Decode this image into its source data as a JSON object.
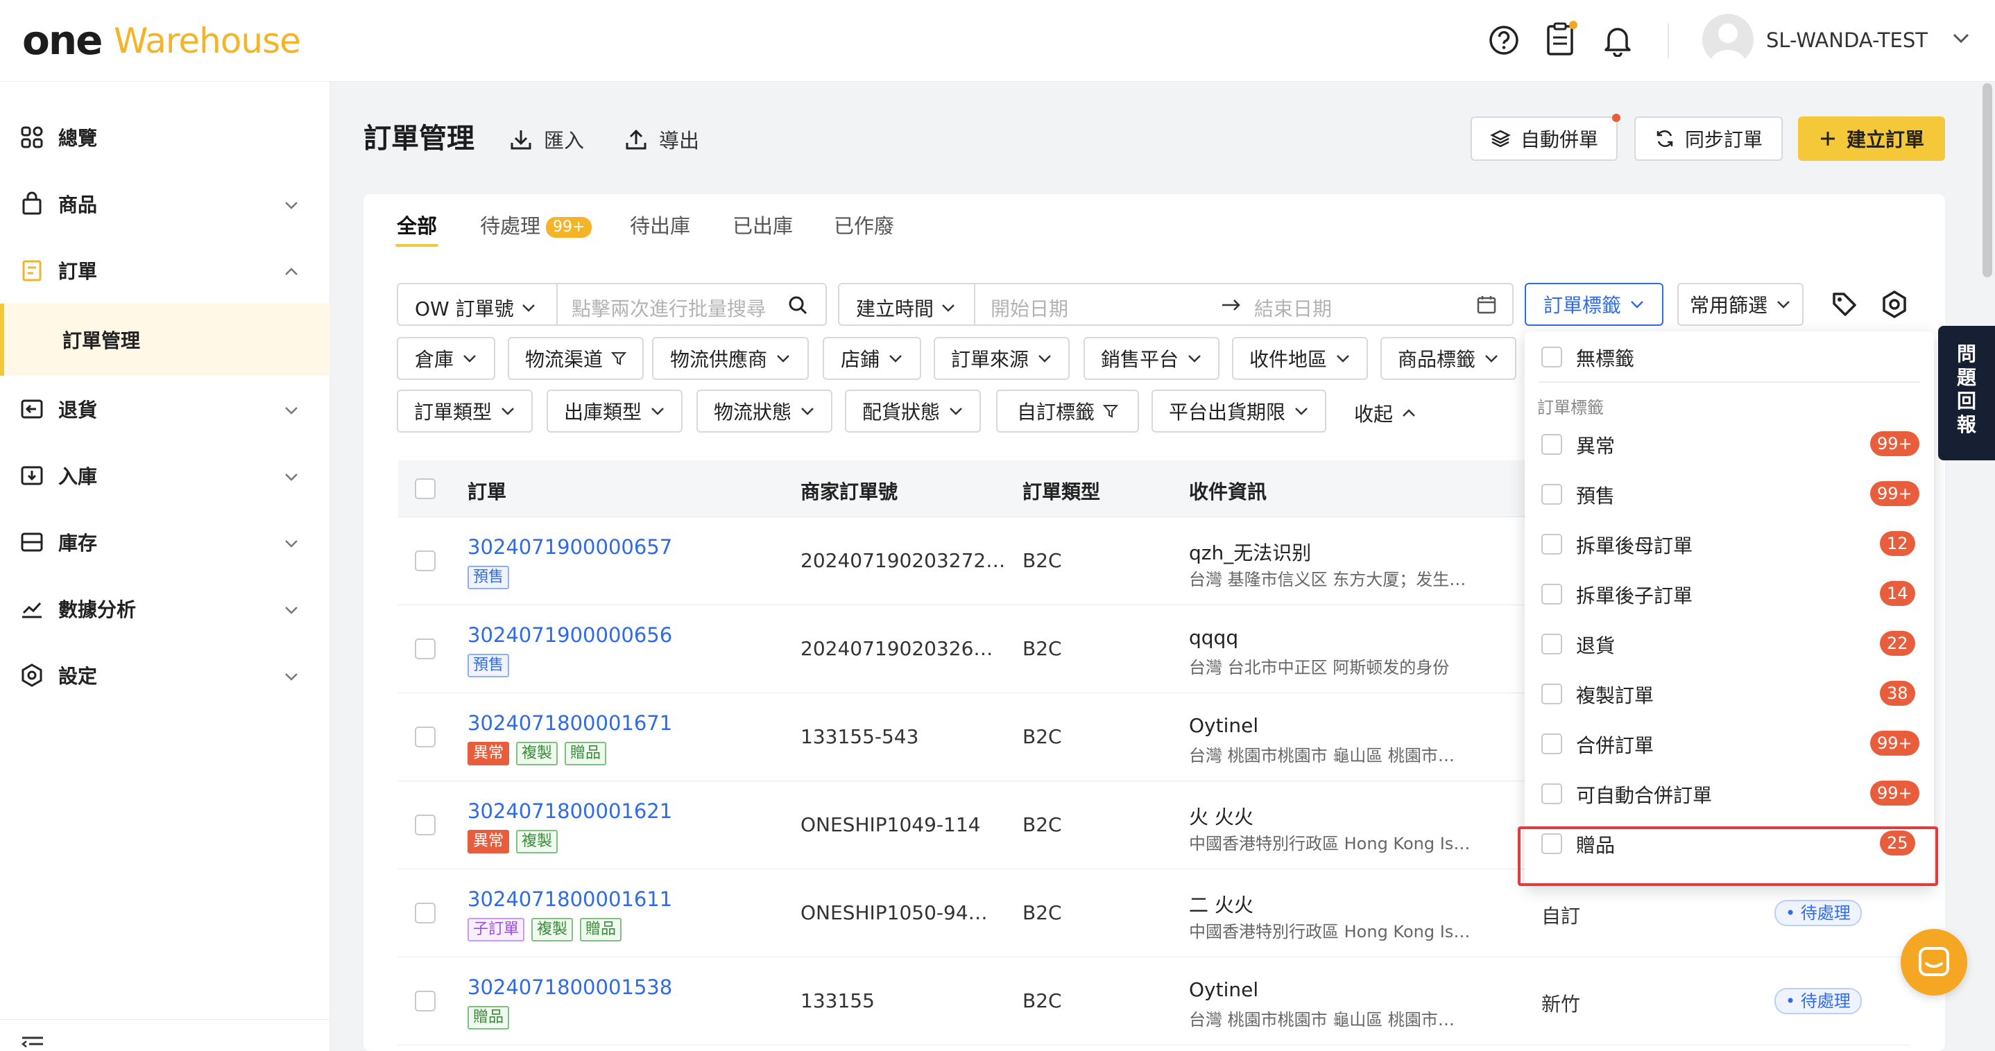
{
  "brand": {
    "part1": "one",
    "part2": "Warehouse"
  },
  "header": {
    "user": "SL-WANDA-TEST"
  },
  "sidebar": {
    "items": [
      {
        "label": "總覽"
      },
      {
        "label": "商品"
      },
      {
        "label": "訂單"
      },
      {
        "label": "訂單管理"
      },
      {
        "label": "退貨"
      },
      {
        "label": "入庫"
      },
      {
        "label": "庫存"
      },
      {
        "label": "數據分析"
      },
      {
        "label": "設定"
      }
    ]
  },
  "page": {
    "title": "訂單管理",
    "import": "匯入",
    "export": "導出",
    "auto_merge": "自動併單",
    "sync": "同步訂單",
    "create": "建立訂單"
  },
  "tabs": [
    {
      "label": "全部"
    },
    {
      "label": "待處理",
      "badge": "99+"
    },
    {
      "label": "待出庫"
    },
    {
      "label": "已出庫"
    },
    {
      "label": "已作廢"
    }
  ],
  "filters": {
    "order_no_select": "OW 訂單號",
    "search_placeholder": "點擊兩次進行批量搜尋",
    "time_select": "建立時間",
    "start_date": "開始日期",
    "end_date": "結束日期",
    "tag_select": "訂單標籤",
    "common": "常用篩選",
    "row2": [
      "倉庫",
      "物流渠道",
      "物流供應商",
      "店鋪",
      "訂單來源",
      "銷售平台",
      "收件地區",
      "商品標籤"
    ],
    "row3": [
      "訂單類型",
      "出庫類型",
      "物流狀態",
      "配貨狀態",
      "自訂標籤",
      "平台出貨期限"
    ],
    "collapse": "收起"
  },
  "table": {
    "headers": [
      "訂單",
      "商家訂單號",
      "訂單類型",
      "收件資訊"
    ],
    "rows": [
      {
        "order": "3024071900000657",
        "tags": [
          {
            "t": "預售",
            "c": "t-pre"
          }
        ],
        "merchant": "202407190203272…",
        "type": "B2C",
        "name": "qzh_无法识别",
        "addr": "台灣 基隆市信义区 东方大厦；发生…",
        "extra": "",
        "status": ""
      },
      {
        "order": "3024071900000656",
        "tags": [
          {
            "t": "預售",
            "c": "t-pre"
          }
        ],
        "merchant": "20240719020326…",
        "type": "B2C",
        "name": "qqqq",
        "addr": "台灣 台北市中正区 阿斯顿发的身份",
        "extra": "",
        "status": ""
      },
      {
        "order": "3024071800001671",
        "tags": [
          {
            "t": "異常",
            "c": "t-err"
          },
          {
            "t": "複製",
            "c": "t-copy"
          },
          {
            "t": "贈品",
            "c": "t-gift"
          }
        ],
        "merchant": "133155-543",
        "type": "B2C",
        "name": "Oytinel",
        "addr": "台灣 桃園市桃園市 龜山區 桃園市…",
        "extra": "",
        "status": ""
      },
      {
        "order": "3024071800001621",
        "tags": [
          {
            "t": "異常",
            "c": "t-err"
          },
          {
            "t": "複製",
            "c": "t-copy"
          }
        ],
        "merchant": "ONESHIP1049-114",
        "type": "B2C",
        "name": "火 火火",
        "addr": "中國香港特別行政區 Hong Kong Is…",
        "extra": "",
        "status": ""
      },
      {
        "order": "3024071800001611",
        "tags": [
          {
            "t": "子訂單",
            "c": "t-sub"
          },
          {
            "t": "複製",
            "c": "t-copy"
          },
          {
            "t": "贈品",
            "c": "t-gift"
          }
        ],
        "merchant": "ONESHIP1050-94…",
        "type": "B2C",
        "name": "二 火火",
        "addr": "中國香港特別行政區 Hong Kong Is…",
        "extra": "自訂",
        "status": "• 待處理"
      },
      {
        "order": "3024071800001538",
        "tags": [
          {
            "t": "贈品",
            "c": "t-gift"
          }
        ],
        "merchant": "133155",
        "type": "B2C",
        "name": "Oytinel",
        "addr": "台灣 桃園市桃園市 龜山區 桃園市…",
        "extra": "新竹",
        "status": "• 待處理"
      }
    ]
  },
  "dropdown": {
    "no_tag": "無標籤",
    "group": "訂單標籤",
    "items": [
      {
        "label": "異常",
        "count": "99+"
      },
      {
        "label": "預售",
        "count": "99+"
      },
      {
        "label": "拆單後母訂單",
        "count": "12"
      },
      {
        "label": "拆單後子訂單",
        "count": "14"
      },
      {
        "label": "退貨",
        "count": "22"
      },
      {
        "label": "複製訂單",
        "count": "38"
      },
      {
        "label": "合併訂單",
        "count": "99+"
      },
      {
        "label": "可自動合併訂單",
        "count": "99+"
      },
      {
        "label": "贈品",
        "count": "25"
      }
    ]
  },
  "feedback": "問題回報",
  "colors": {
    "accent": "#f5c83a",
    "link": "#2f6be6",
    "danger": "#e85d3b"
  }
}
